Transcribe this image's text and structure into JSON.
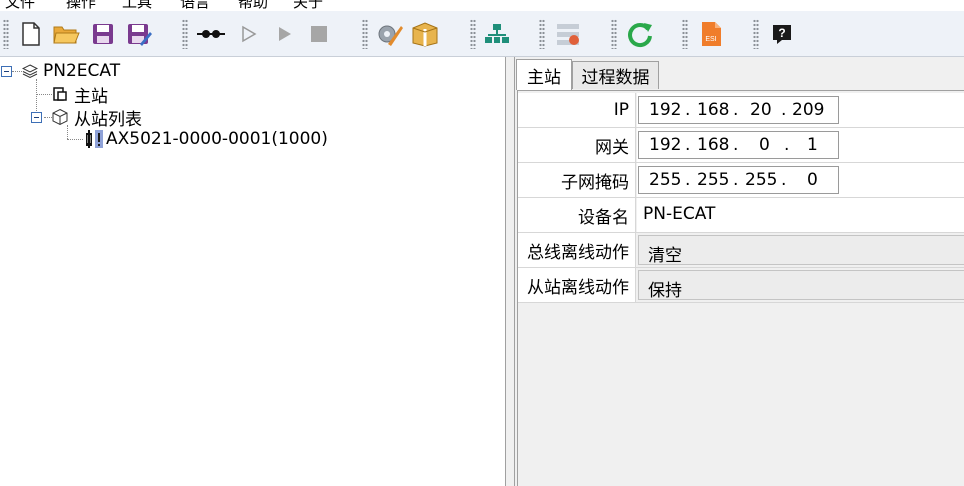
{
  "menu": [
    "文件",
    "操作",
    "工具",
    "语言",
    "帮助",
    "关于"
  ],
  "toolbar": {
    "icons": [
      "new-file-icon",
      "open-folder-icon",
      "save-icon",
      "save-as-icon",
      "connect-icon",
      "start-outline-icon",
      "run-icon",
      "stop-icon",
      "config-wrench-icon",
      "package-icon",
      "network-topology-icon",
      "device-list-icon",
      "refresh-icon",
      "esi-icon",
      "help-icon"
    ],
    "esi_label": "ESI",
    "help_label": "?"
  },
  "tree": {
    "root": "PN2ECAT",
    "master": "主站",
    "slave_list": "从站列表",
    "slave_item": "AX5021-0000-0001(1000)"
  },
  "tabs": [
    "主站",
    "过程数据"
  ],
  "props": {
    "ip_label": "IP",
    "ip": [
      "192",
      "168",
      "20",
      "209"
    ],
    "gateway_label": "网关",
    "gateway": [
      "192",
      "168",
      "0",
      "1"
    ],
    "mask_label": "子网掩码",
    "mask": [
      "255",
      "255",
      "255",
      "0"
    ],
    "device_label": "设备名",
    "device_value": "PN-ECAT",
    "bus_label": "总线离线动作",
    "bus_value": "清空",
    "slave_label": "从站离线动作",
    "slave_value": "保持"
  }
}
